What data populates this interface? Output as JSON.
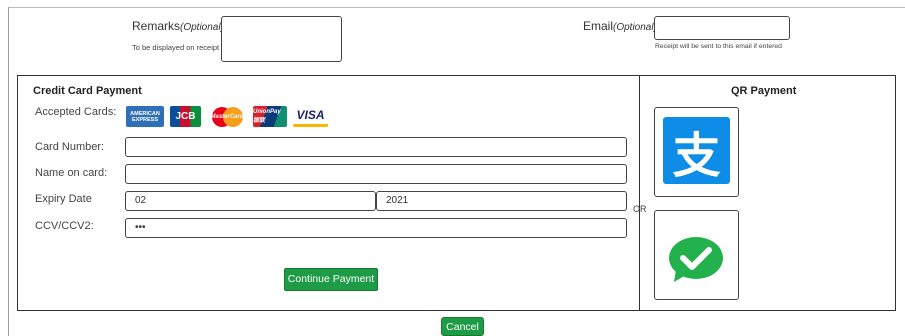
{
  "remarks": {
    "label": "Remarks",
    "optional": "(Optional)",
    "sub": "To be displayed on receipt"
  },
  "email": {
    "label": "Email",
    "optional": "(Optional)",
    "sub": "Receipt will be sent to this email if entered"
  },
  "credit_card": {
    "title": "Credit Card Payment",
    "accepted_cards_label": "Accepted Cards:",
    "card_icons": [
      "american-express-logo",
      "jcb-logo",
      "mastercard-logo",
      "unionpay-logo",
      "visa-logo"
    ],
    "card_icon_text": {
      "amex": "AMERICAN EXPRESS",
      "jcb": "JCB",
      "mastercard": "MasterCard",
      "unionpay": "UnionPay 银联",
      "visa": "VISA"
    },
    "card_number_label": "Card Number:",
    "card_number_value": "",
    "name_label": "Name on card:",
    "name_value": "",
    "expiry_label": "Expiry Date",
    "expiry_month": "02",
    "expiry_year": "2021",
    "ccv_label": "CCV/CCV2:",
    "ccv_value": "•••",
    "continue_button": "Continue Payment"
  },
  "or_label": "OR",
  "qr": {
    "title": "QR Payment",
    "icons": [
      "alipay-icon",
      "wechat-pay-icon"
    ],
    "alipay_glyph": "支"
  },
  "cancel_button": "Cancel",
  "colors": {
    "button_green": "#1e9c45",
    "alipay_blue": "#0e8de8",
    "wechat_green": "#22b14c"
  }
}
